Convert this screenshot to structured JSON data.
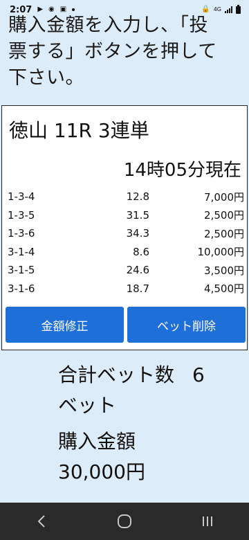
{
  "status_bar": {
    "time": "2:07",
    "network": "4G"
  },
  "instruction": {
    "line1": "購入金額を入力し、「投",
    "line2": "票する」ボタンを押して",
    "line3": "下さい。"
  },
  "race": {
    "title": "徳山 11R 3連単",
    "as_of": "14時05分現在"
  },
  "bets": [
    {
      "combo": "1-3-4",
      "odds": "12.8",
      "amount": "7,000円"
    },
    {
      "combo": "1-3-5",
      "odds": "31.5",
      "amount": "2,500円"
    },
    {
      "combo": "1-3-6",
      "odds": "34.3",
      "amount": "2,500円"
    },
    {
      "combo": "3-1-4",
      "odds": "8.6",
      "amount": "10,000円"
    },
    {
      "combo": "3-1-5",
      "odds": "24.6",
      "amount": "3,500円"
    },
    {
      "combo": "3-1-6",
      "odds": "18.7",
      "amount": "4,500円"
    }
  ],
  "buttons": {
    "edit_amount": "金額修正",
    "delete_bet": "ベット削除"
  },
  "summary": {
    "total_bets_label": "合計ベット数",
    "total_bets_value": "6",
    "total_bets_unit": "ベット",
    "amount_label": "購入金額",
    "amount_value": "30,000円"
  },
  "colors": {
    "background": "#dcecf8",
    "button": "#1f6fd8",
    "nav_bar": "#2a2a2a"
  },
  "icons": [
    "back-icon",
    "home-icon",
    "recents-icon"
  ]
}
